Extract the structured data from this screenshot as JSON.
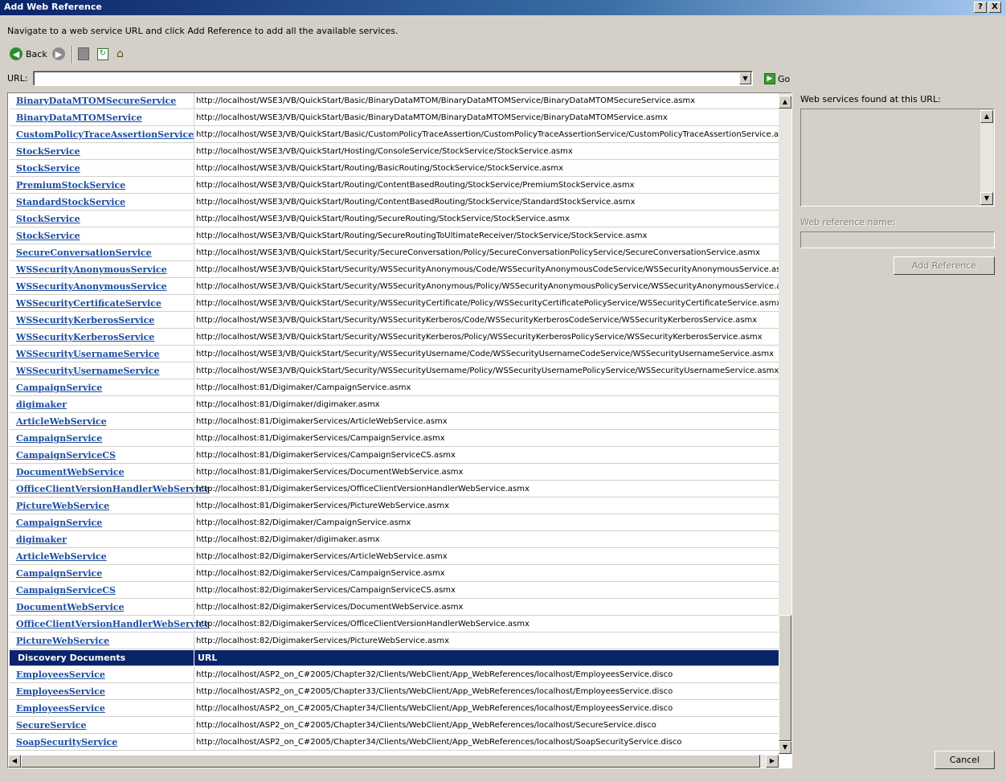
{
  "window": {
    "title": "Add Web Reference",
    "help_glyph": "?",
    "close_glyph": "X"
  },
  "instructions": "Navigate to a web service URL and click Add Reference to add all the available services.",
  "toolbar": {
    "back_label": "Back"
  },
  "url_bar": {
    "label": "URL:",
    "value": "",
    "go_label": "Go"
  },
  "services": [
    {
      "name": "BinaryDataMTOMSecureService",
      "url": "http://localhost/WSE3/VB/QuickStart/Basic/BinaryDataMTOM/BinaryDataMTOMService/BinaryDataMTOMSecureService.asmx"
    },
    {
      "name": "BinaryDataMTOMService",
      "url": "http://localhost/WSE3/VB/QuickStart/Basic/BinaryDataMTOM/BinaryDataMTOMService/BinaryDataMTOMService.asmx"
    },
    {
      "name": "CustomPolicyTraceAssertionService",
      "url": "http://localhost/WSE3/VB/QuickStart/Basic/CustomPolicyTraceAssertion/CustomPolicyTraceAssertionService/CustomPolicyTraceAssertionService.asmx"
    },
    {
      "name": "StockService",
      "url": "http://localhost/WSE3/VB/QuickStart/Hosting/ConsoleService/StockService/StockService.asmx"
    },
    {
      "name": "StockService",
      "url": "http://localhost/WSE3/VB/QuickStart/Routing/BasicRouting/StockService/StockService.asmx"
    },
    {
      "name": "PremiumStockService",
      "url": "http://localhost/WSE3/VB/QuickStart/Routing/ContentBasedRouting/StockService/PremiumStockService.asmx"
    },
    {
      "name": "StandardStockService",
      "url": "http://localhost/WSE3/VB/QuickStart/Routing/ContentBasedRouting/StockService/StandardStockService.asmx"
    },
    {
      "name": "StockService",
      "url": "http://localhost/WSE3/VB/QuickStart/Routing/SecureRouting/StockService/StockService.asmx"
    },
    {
      "name": "StockService",
      "url": "http://localhost/WSE3/VB/QuickStart/Routing/SecureRoutingToUltimateReceiver/StockService/StockService.asmx"
    },
    {
      "name": "SecureConversationService",
      "url": "http://localhost/WSE3/VB/QuickStart/Security/SecureConversation/Policy/SecureConversationPolicyService/SecureConversationService.asmx"
    },
    {
      "name": "WSSecurityAnonymousService",
      "url": "http://localhost/WSE3/VB/QuickStart/Security/WSSecurityAnonymous/Code/WSSecurityAnonymousCodeService/WSSecurityAnonymousService.asmx"
    },
    {
      "name": "WSSecurityAnonymousService",
      "url": "http://localhost/WSE3/VB/QuickStart/Security/WSSecurityAnonymous/Policy/WSSecurityAnonymousPolicyService/WSSecurityAnonymousService.asmx"
    },
    {
      "name": "WSSecurityCertificateService",
      "url": "http://localhost/WSE3/VB/QuickStart/Security/WSSecurityCertificate/Policy/WSSecurityCertificatePolicyService/WSSecurityCertificateService.asmx"
    },
    {
      "name": "WSSecurityKerberosService",
      "url": "http://localhost/WSE3/VB/QuickStart/Security/WSSecurityKerberos/Code/WSSecurityKerberosCodeService/WSSecurityKerberosService.asmx"
    },
    {
      "name": "WSSecurityKerberosService",
      "url": "http://localhost/WSE3/VB/QuickStart/Security/WSSecurityKerberos/Policy/WSSecurityKerberosPolicyService/WSSecurityKerberosService.asmx"
    },
    {
      "name": "WSSecurityUsernameService",
      "url": "http://localhost/WSE3/VB/QuickStart/Security/WSSecurityUsername/Code/WSSecurityUsernameCodeService/WSSecurityUsernameService.asmx"
    },
    {
      "name": "WSSecurityUsernameService",
      "url": "http://localhost/WSE3/VB/QuickStart/Security/WSSecurityUsername/Policy/WSSecurityUsernamePolicyService/WSSecurityUsernameService.asmx"
    },
    {
      "name": "CampaignService",
      "url": "http://localhost:81/Digimaker/CampaignService.asmx"
    },
    {
      "name": "digimaker",
      "url": "http://localhost:81/Digimaker/digimaker.asmx"
    },
    {
      "name": "ArticleWebService",
      "url": "http://localhost:81/DigimakerServices/ArticleWebService.asmx"
    },
    {
      "name": "CampaignService",
      "url": "http://localhost:81/DigimakerServices/CampaignService.asmx"
    },
    {
      "name": "CampaignServiceCS",
      "url": "http://localhost:81/DigimakerServices/CampaignServiceCS.asmx"
    },
    {
      "name": "DocumentWebService",
      "url": "http://localhost:81/DigimakerServices/DocumentWebService.asmx"
    },
    {
      "name": "OfficeClientVersionHandlerWebService",
      "url": "http://localhost:81/DigimakerServices/OfficeClientVersionHandlerWebService.asmx"
    },
    {
      "name": "PictureWebService",
      "url": "http://localhost:81/DigimakerServices/PictureWebService.asmx"
    },
    {
      "name": "CampaignService",
      "url": "http://localhost:82/Digimaker/CampaignService.asmx"
    },
    {
      "name": "digimaker",
      "url": "http://localhost:82/Digimaker/digimaker.asmx"
    },
    {
      "name": "ArticleWebService",
      "url": "http://localhost:82/DigimakerServices/ArticleWebService.asmx"
    },
    {
      "name": "CampaignService",
      "url": "http://localhost:82/DigimakerServices/CampaignService.asmx"
    },
    {
      "name": "CampaignServiceCS",
      "url": "http://localhost:82/DigimakerServices/CampaignServiceCS.asmx"
    },
    {
      "name": "DocumentWebService",
      "url": "http://localhost:82/DigimakerServices/DocumentWebService.asmx"
    },
    {
      "name": "OfficeClientVersionHandlerWebService",
      "url": "http://localhost:82/DigimakerServices/OfficeClientVersionHandlerWebService.asmx"
    },
    {
      "name": "PictureWebService",
      "url": "http://localhost:82/DigimakerServices/PictureWebService.asmx"
    }
  ],
  "discovery_header": {
    "name": "Discovery Documents",
    "url": "URL"
  },
  "discovery_documents": [
    {
      "name": "EmployeesService",
      "url": "http://localhost/ASP2_on_C#2005/Chapter32/Clients/WebClient/App_WebReferences/localhost/EmployeesService.disco"
    },
    {
      "name": "EmployeesService",
      "url": "http://localhost/ASP2_on_C#2005/Chapter33/Clients/WebClient/App_WebReferences/localhost/EmployeesService.disco"
    },
    {
      "name": "EmployeesService",
      "url": "http://localhost/ASP2_on_C#2005/Chapter34/Clients/WebClient/App_WebReferences/localhost/EmployeesService.disco"
    },
    {
      "name": "SecureService",
      "url": "http://localhost/ASP2_on_C#2005/Chapter34/Clients/WebClient/App_WebReferences/localhost/SecureService.disco"
    },
    {
      "name": "SoapSecurityService",
      "url": "http://localhost/ASP2_on_C#2005/Chapter34/Clients/WebClient/App_WebReferences/localhost/SoapSecurityService.disco"
    }
  ],
  "right_panel": {
    "found_label": "Web services found at this URL:",
    "ref_name_label": "Web reference name:",
    "ref_name_value": "",
    "add_reference_label": "Add Reference"
  },
  "footer": {
    "cancel_label": "Cancel"
  },
  "colors": {
    "link": "#1a4ca0",
    "header_bg": "#0a246a",
    "dialog_bg": "#d4d0c8"
  },
  "icons": [
    "back-icon",
    "forward-icon",
    "stop-icon",
    "refresh-icon",
    "home-icon",
    "go-icon",
    "combo-dropdown-icon"
  ]
}
